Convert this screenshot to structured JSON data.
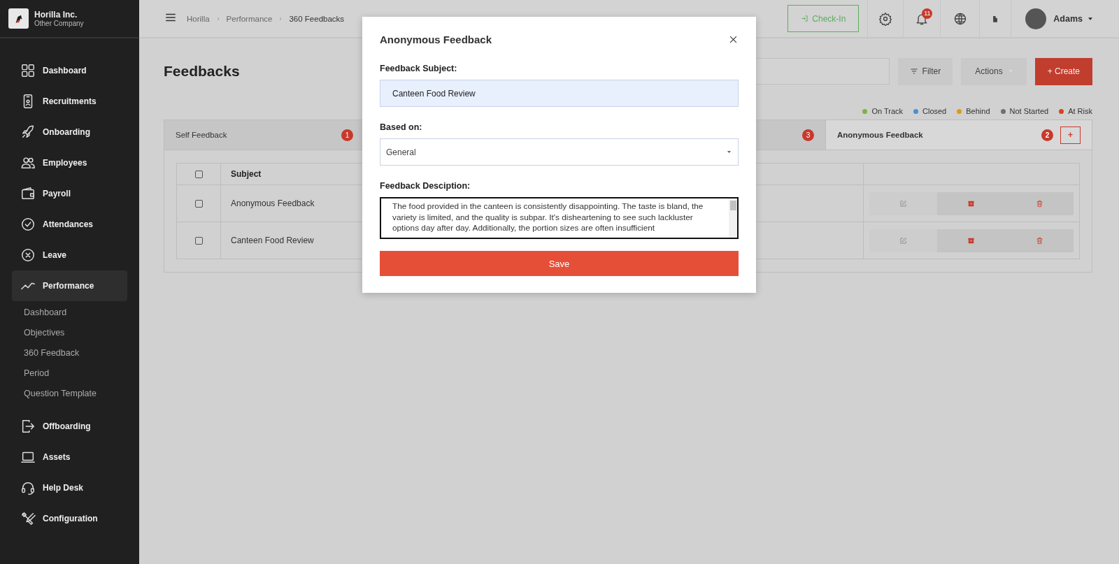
{
  "sidebar": {
    "company": {
      "name": "Horilla Inc.",
      "subtitle": "Other Company"
    },
    "items": [
      {
        "label": "Dashboard",
        "selected": false
      },
      {
        "label": "Recruitments",
        "selected": false
      },
      {
        "label": "Onboarding",
        "selected": false
      },
      {
        "label": "Employees",
        "selected": false
      },
      {
        "label": "Payroll",
        "selected": false
      },
      {
        "label": "Attendances",
        "selected": false
      },
      {
        "label": "Leave",
        "selected": false
      },
      {
        "label": "Performance",
        "selected": true,
        "children": [
          {
            "label": "Dashboard"
          },
          {
            "label": "Objectives"
          },
          {
            "label": "360 Feedback"
          },
          {
            "label": "Period"
          },
          {
            "label": "Question Template"
          }
        ]
      },
      {
        "label": "Offboarding",
        "selected": false
      },
      {
        "label": "Assets",
        "selected": false
      },
      {
        "label": "Help Desk",
        "selected": false
      },
      {
        "label": "Configuration",
        "selected": false
      }
    ]
  },
  "topbar": {
    "breadcrumb": [
      "Horilla",
      "Performance",
      "360 Feedbacks"
    ],
    "check_in": "Check-In",
    "notification_count": "11",
    "user": "Adams"
  },
  "page": {
    "title": "Feedbacks",
    "filter": "Filter",
    "actions": "Actions",
    "create": "+ Create",
    "legend": [
      {
        "label": "On Track",
        "color": "#7cb342"
      },
      {
        "label": "Closed",
        "color": "#4a90d9"
      },
      {
        "label": "Behind",
        "color": "#e39a12"
      },
      {
        "label": "Not Started",
        "color": "#707070"
      },
      {
        "label": "At Risk",
        "color": "#d8401f"
      }
    ],
    "tabs": [
      {
        "label": "Self Feedback",
        "count": "1",
        "selected": false
      },
      {
        "count": "3",
        "selected": false
      },
      {
        "label": "Anonymous Feedback",
        "count": "2",
        "selected": true
      }
    ],
    "add_tab": "+",
    "table": {
      "header_checked": false,
      "columns": [
        "Subject"
      ],
      "rows": [
        {
          "subject": "Anonymous Feedback",
          "checked": false
        },
        {
          "subject": "Canteen Food Review",
          "checked": false
        }
      ]
    }
  },
  "modal": {
    "title": "Anonymous Feedback",
    "subject_label": "Feedback Subject:",
    "subject_value": "Canteen Food Review",
    "based_on_label": "Based on:",
    "based_on_value": "General",
    "description_label": "Feedback Desciption:",
    "description_value": "The food provided in the canteen is consistently disappointing. The taste is bland, the variety is limited, and the quality is subpar. It's disheartening to see such lackluster options day after day. Additionally, the portion sizes are often insufficient",
    "save": "Save"
  }
}
